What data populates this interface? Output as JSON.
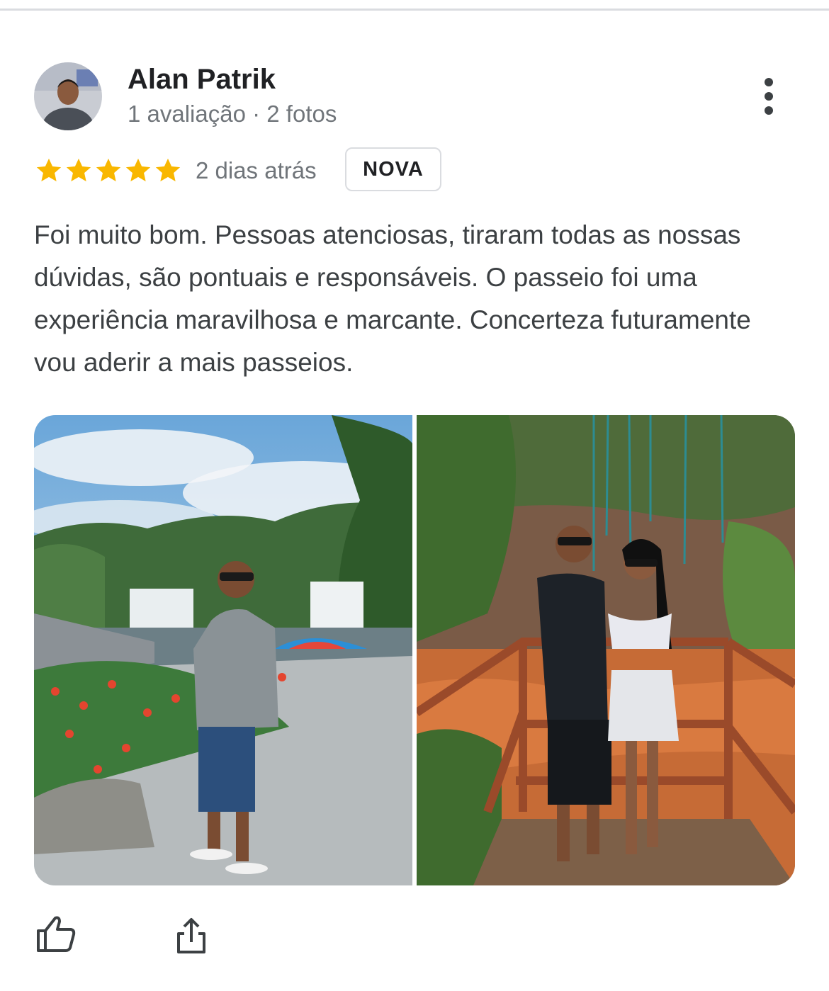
{
  "review": {
    "author_name": "Alan Patrik",
    "author_meta": "1 avaliação · 2 fotos",
    "rating": 5,
    "rating_max": 5,
    "date": "2 dias atrás",
    "badge": "NOVA",
    "text": "Foi muito bom. Pessoas atenciosas, tiraram todas as nossas dúvidas, são pontuais e responsáveis. O passeio foi uma experiência maravilhosa e marcante. Concerteza futuramente vou aderir a mais passeios.",
    "photos": [
      {
        "icon": "waterfall-photo"
      },
      {
        "icon": "couple-photo"
      }
    ]
  },
  "colors": {
    "star": "#f9b700",
    "text_primary": "#202124",
    "text_secondary": "#70757a",
    "border": "#dadce0"
  },
  "actions": {
    "like_icon": "thumbs-up-icon",
    "share_icon": "share-icon",
    "more_icon": "more-vert-icon"
  }
}
